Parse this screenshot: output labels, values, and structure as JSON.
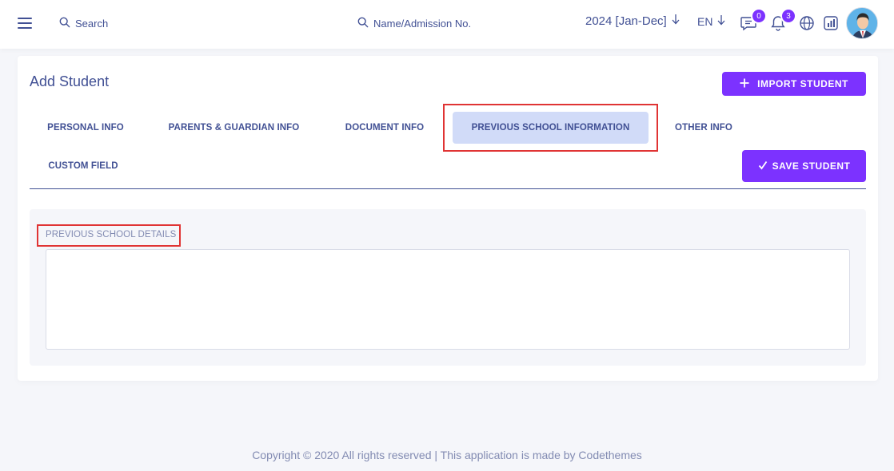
{
  "header": {
    "search_label": "Search",
    "student_search_label": "Name/Admission No.",
    "session": "2024 [Jan-Dec]",
    "language": "EN",
    "messages_count": "0",
    "notifications_count": "3"
  },
  "page": {
    "title": "Add Student",
    "import_button": "IMPORT STUDENT",
    "save_button": "SAVE STUDENT"
  },
  "tabs": [
    {
      "label": "PERSONAL INFO"
    },
    {
      "label": "PARENTS & GUARDIAN INFO"
    },
    {
      "label": "DOCUMENT INFO"
    },
    {
      "label": "PREVIOUS SCHOOL INFORMATION",
      "active": true
    },
    {
      "label": "OTHER INFO"
    },
    {
      "label": "CUSTOM FIELD"
    }
  ],
  "form": {
    "section_label": "PREVIOUS SCHOOL DETAILS",
    "details_value": ""
  },
  "footer": {
    "text": "Copyright © 2020 All rights reserved | This application is made by Codethemes"
  },
  "colors": {
    "accent": "#7c32ff",
    "text": "#415094",
    "active_tab_bg": "#d1dbf8",
    "highlight_box": "#e03434"
  }
}
